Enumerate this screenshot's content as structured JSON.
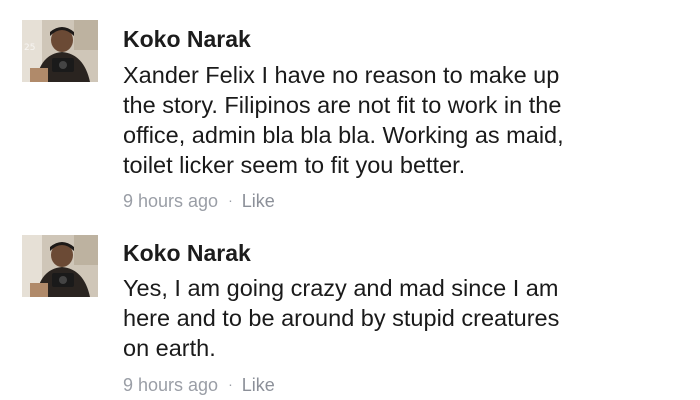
{
  "comments": [
    {
      "author": "Koko Narak",
      "lines": [
        "Xander Felix I have no reason to make up",
        "the story. Filipinos are not fit to work in the",
        "office, admin bla bla bla. Working as maid,",
        "toilet licker seem to fit you better."
      ],
      "timestamp": "9 hours ago",
      "separator": "·",
      "like_label": "Like"
    },
    {
      "author": "Koko Narak",
      "lines": [
        "Yes, I am going crazy and mad since I am",
        "here and to be around by stupid creatures",
        "on earth."
      ],
      "timestamp": "9 hours ago",
      "separator": "·",
      "like_label": "Like"
    }
  ]
}
